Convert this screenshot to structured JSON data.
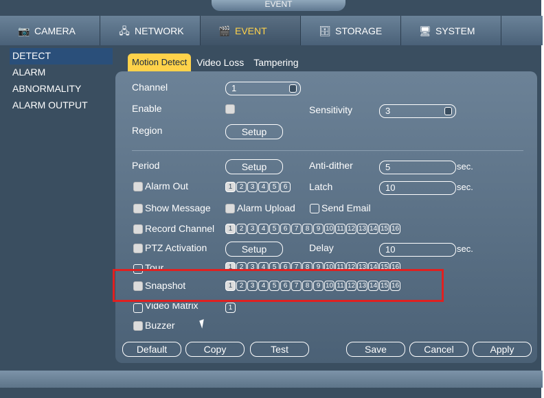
{
  "window": {
    "title": "EVENT"
  },
  "nav": {
    "tabs": [
      {
        "label": "CAMERA",
        "icon": "camera-icon"
      },
      {
        "label": "NETWORK",
        "icon": "network-icon"
      },
      {
        "label": "EVENT",
        "icon": "event-icon"
      },
      {
        "label": "STORAGE",
        "icon": "storage-icon"
      },
      {
        "label": "SYSTEM",
        "icon": "system-icon"
      }
    ]
  },
  "sidebar": {
    "items": [
      {
        "label": "DETECT"
      },
      {
        "label": "ALARM"
      },
      {
        "label": "ABNORMALITY"
      },
      {
        "label": "ALARM OUTPUT"
      }
    ]
  },
  "subtabs": [
    {
      "label": "Motion Detect"
    },
    {
      "label": "Video Loss"
    },
    {
      "label": "Tampering"
    }
  ],
  "form": {
    "channel": {
      "label": "Channel",
      "value": "1"
    },
    "enable": {
      "label": "Enable",
      "checked": true
    },
    "sensitivity": {
      "label": "Sensitivity",
      "value": "3"
    },
    "region": {
      "label": "Region",
      "button": "Setup"
    },
    "period": {
      "label": "Period",
      "button": "Setup"
    },
    "anti_dither": {
      "label": "Anti-dither",
      "value": "5",
      "unit": "sec."
    },
    "alarm_out": {
      "label": "Alarm Out",
      "checked": true,
      "outputs": [
        "1",
        "2",
        "3",
        "4",
        "5",
        "6"
      ]
    },
    "latch": {
      "label": "Latch",
      "value": "10",
      "unit": "sec."
    },
    "show_message": {
      "label": "Show Message",
      "checked": true
    },
    "alarm_upload": {
      "label": "Alarm Upload",
      "checked": true
    },
    "send_email": {
      "label": "Send Email",
      "checked": false
    },
    "record_channel": {
      "label": "Record Channel",
      "checked": true
    },
    "ptz_activation": {
      "label": "PTZ Activation",
      "checked": true,
      "button": "Setup"
    },
    "delay": {
      "label": "Delay",
      "value": "10",
      "unit": "sec."
    },
    "tour": {
      "label": "Tour",
      "checked": false
    },
    "snapshot": {
      "label": "Snapshot",
      "checked": true
    },
    "video_matrix": {
      "label": "Video Matrix",
      "checked": false,
      "channels": [
        "1"
      ]
    },
    "buzzer": {
      "label": "Buzzer",
      "checked": true
    },
    "channels16": [
      "1",
      "2",
      "3",
      "4",
      "5",
      "6",
      "7",
      "8",
      "9",
      "10",
      "11",
      "12",
      "13",
      "14",
      "15",
      "16"
    ]
  },
  "buttons": {
    "default": "Default",
    "copy": "Copy",
    "test": "Test",
    "save": "Save",
    "cancel": "Cancel",
    "apply": "Apply"
  },
  "colors": {
    "accent": "#ffd24a",
    "highlight": "#e02020",
    "panel": "#5a7086"
  }
}
